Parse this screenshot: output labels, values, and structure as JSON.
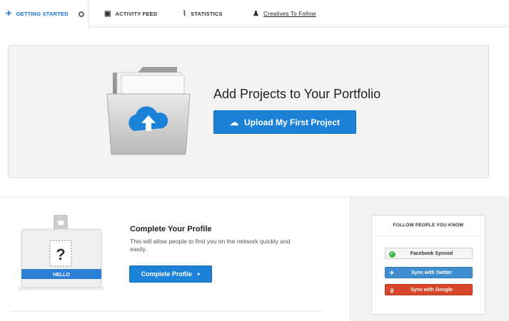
{
  "tabs": [
    {
      "label": "GETTING STARTED",
      "icon": "plane-icon",
      "active": true
    },
    {
      "label": "ACTIVITY FEED",
      "icon": "feed-icon"
    },
    {
      "label": "STATISTICS",
      "icon": "pulse-icon"
    },
    {
      "label": "Creatives To Follow",
      "icon": "people-icon"
    }
  ],
  "hero": {
    "title": "Add Projects to Your Portfolio",
    "upload_label": "Upload My First Project"
  },
  "profile": {
    "title": "Complete Your Profile",
    "text": "This will allow people to find you on the network quickly and easily.",
    "button_label": "Complete Profile",
    "badge_mark": "?",
    "badge_label": "HELLO"
  },
  "follow": {
    "title": "FOLLOW PEOPLE YOU KNOW",
    "facebook": "Facebook Synced",
    "twitter": "Sync with Twitter",
    "google": "Sync with Google"
  },
  "colors": {
    "accent": "#1b82d8",
    "twitter": "#3f8fd0",
    "google": "#d9472b",
    "synced": "#3eb84a"
  }
}
